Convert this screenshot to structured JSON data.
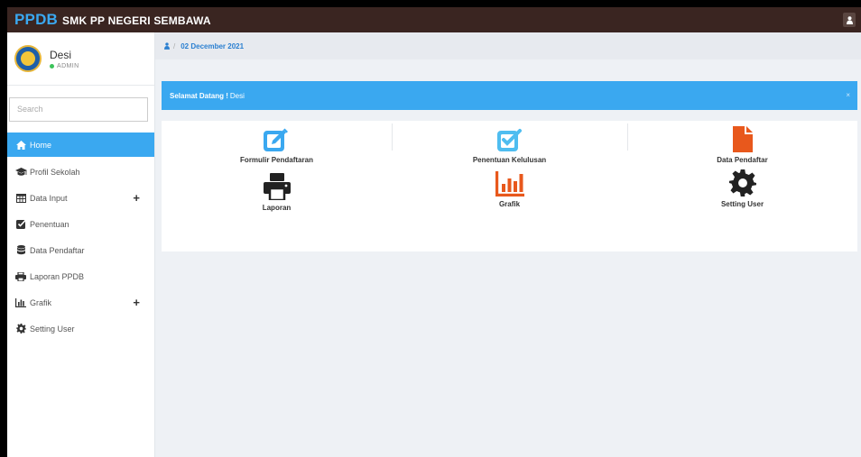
{
  "header": {
    "brand_strong": "PPDB",
    "brand_rest": "SMK PP NEGERI SEMBAWA",
    "colors": {
      "bar": "#3a2521",
      "brand": "#3aa8f0"
    },
    "user_icon": "user-icon"
  },
  "profile": {
    "name": "Desi",
    "role": "ADMIN",
    "status_color": "#3cc35a"
  },
  "search": {
    "placeholder": "Search",
    "value": ""
  },
  "sidebar": {
    "active_color": "#3aa8f0",
    "items": [
      {
        "label": "Home",
        "icon": "home-icon",
        "active": true
      },
      {
        "label": "Profil Sekolah",
        "icon": "graduation-cap-icon"
      },
      {
        "label": "Data Input",
        "icon": "table-icon",
        "expand": "+"
      },
      {
        "label": "Penentuan",
        "icon": "check-square-icon"
      },
      {
        "label": "Data Pendaftar",
        "icon": "database-icon"
      },
      {
        "label": "Laporan PPDB",
        "icon": "print-icon"
      },
      {
        "label": "Grafik",
        "icon": "bar-chart-icon",
        "expand": "+"
      },
      {
        "label": "Setting User",
        "icon": "cog-icon"
      }
    ]
  },
  "breadcrumb": {
    "date": "02 December 2021",
    "separator": "/",
    "icon": "user-icon"
  },
  "welcome": {
    "greeting": "Selamat Datang !",
    "name": "Desi",
    "close": "×"
  },
  "tiles": [
    {
      "label": "Formulir Pendaftaran",
      "icon": "edit-icon",
      "color": "#3aa8f0"
    },
    {
      "label": "Penentuan Kelulusan",
      "icon": "check-square-icon",
      "color": "#4fbdf0"
    },
    {
      "label": "Data Pendaftar",
      "icon": "file-icon",
      "color": "#e8581c"
    },
    {
      "label": "Laporan",
      "icon": "print-icon",
      "color": "#222222"
    },
    {
      "label": "Grafik",
      "icon": "bar-chart-icon",
      "color": "#e8581c"
    },
    {
      "label": "Setting User",
      "icon": "cog-icon",
      "color": "#222222"
    }
  ]
}
